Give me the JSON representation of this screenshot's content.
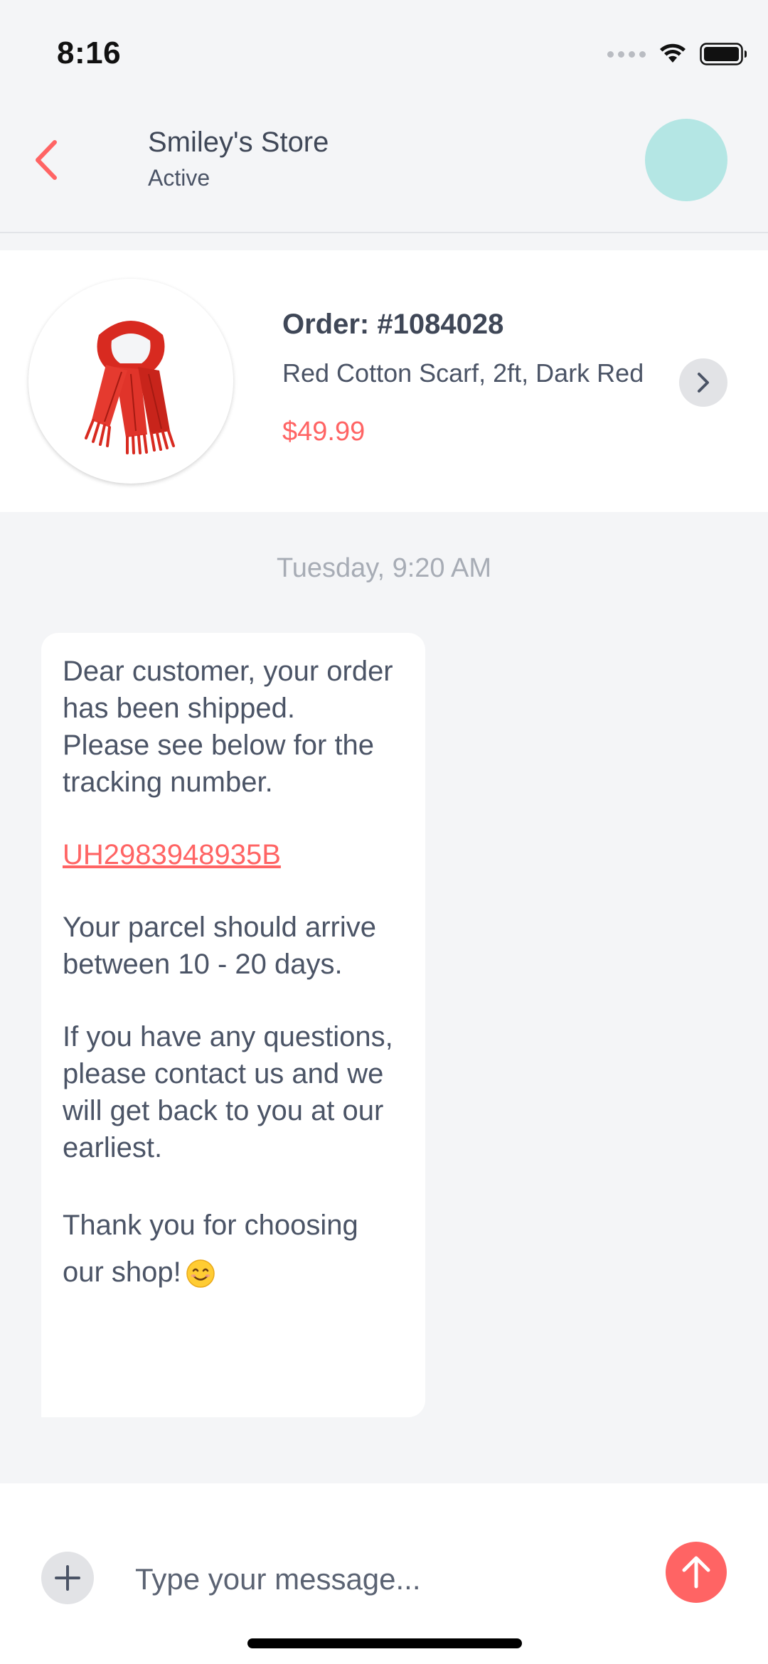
{
  "status_bar": {
    "time": "8:16",
    "icons": [
      "signal-icon",
      "wifi-icon",
      "battery-icon"
    ]
  },
  "header": {
    "back_icon": "chevron-left-icon",
    "store_name": "Smiley's Store",
    "store_status": "Active",
    "avatar_color": "#b4e6e4"
  },
  "order": {
    "product_icon": "scarf-image",
    "number": "Order: #1084028",
    "description": "Red Cotton Scarf, 2ft, Dark Red",
    "price": "$49.99",
    "arrow_icon": "chevron-right-icon"
  },
  "conversation": {
    "date": "Tuesday, 9:20 AM",
    "message": {
      "line1": "Dear customer, your order has been shipped.",
      "line2": "Please see below for the tracking number.",
      "tracking_number": "UH2983948935B",
      "line3": "Your parcel should arrive between 10 - 20 days.",
      "line4": "If you have any questions, please contact us and we will get back to you at our earliest.",
      "line5": "Thank you for choosing our shop!",
      "emoji_icon": "smiling-face-emoji"
    }
  },
  "composer": {
    "add_icon": "plus-icon",
    "placeholder": "Type your message...",
    "send_icon": "arrow-up-icon"
  },
  "colors": {
    "accent": "#ff6464",
    "text": "#4b5466",
    "background": "#f4f5f7",
    "muted": "#a7acb5"
  }
}
